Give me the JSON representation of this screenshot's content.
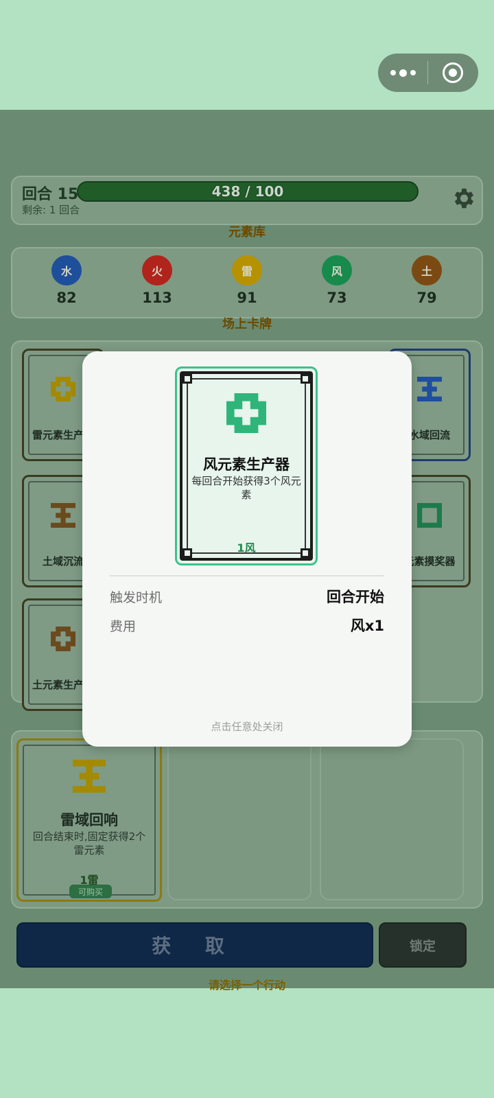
{
  "header": {
    "round_label": "回合 15",
    "remaining": "剩余: 1 回合",
    "progress_text": "438 / 100",
    "progress_fraction": 1.0
  },
  "sections": {
    "element_pool": "元素库",
    "field_cards": "场上卡牌"
  },
  "elements": [
    {
      "name": "水",
      "value": "82",
      "color": "#1e4f9a"
    },
    {
      "name": "火",
      "value": "113",
      "color": "#b0241c"
    },
    {
      "name": "雷",
      "value": "91",
      "color": "#b69100"
    },
    {
      "name": "风",
      "value": "73",
      "color": "#178a4c"
    },
    {
      "name": "土",
      "value": "79",
      "color": "#7a4a12"
    }
  ],
  "field": {
    "cards": [
      {
        "name": "雷元素生产器",
        "icon": "thunder-producer-icon",
        "color": "#a38a00"
      },
      {
        "name": "水域回流",
        "icon": "water-flow-icon",
        "color": "#1f4e9e"
      },
      {
        "name": "土域沉流",
        "icon": "earth-flow-icon",
        "color": "#6b4a1d"
      },
      {
        "name": "元素摸奖器",
        "icon": "lottery-icon",
        "color": "#1d7a4b"
      },
      {
        "name": "土元素生产器",
        "icon": "earth-producer-icon",
        "color": "#6b4a1d"
      }
    ]
  },
  "shop": {
    "card": {
      "name": "雷域回响",
      "desc": "回合结束时,固定获得2个雷元素",
      "cost": "1雷",
      "badge": "可购买",
      "color": "#a38a00"
    }
  },
  "actions": {
    "acquire": "获 取",
    "lock": "锁定",
    "hint": "请选择一个行动"
  },
  "modal": {
    "card_name": "风元素生产器",
    "card_desc": "每回合开始获得3个风元素",
    "card_cost": "1风",
    "trigger_label": "触发时机",
    "trigger_value": "回合开始",
    "cost_label": "费用",
    "cost_value": "风x1",
    "close_hint": "点击任意处关闭",
    "accent": "#3cc28a"
  }
}
